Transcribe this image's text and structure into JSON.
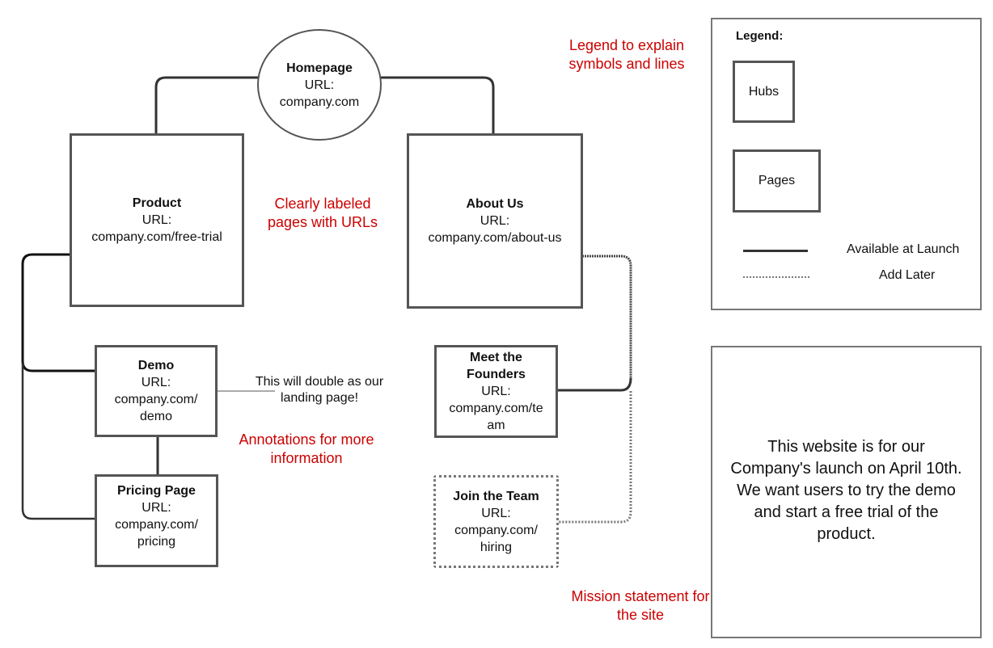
{
  "nodes": {
    "homepage": {
      "title": "Homepage",
      "url_label": "URL:",
      "url": "company.com"
    },
    "product": {
      "title": "Product",
      "url_label": "URL:",
      "url": "company.com/free-trial"
    },
    "about": {
      "title": "About Us",
      "url_label": "URL:",
      "url": "company.com/about-us"
    },
    "demo": {
      "title": "Demo",
      "url_label": "URL:",
      "url": "company.com/ demo"
    },
    "pricing": {
      "title": "Pricing Page",
      "url_label": "URL:",
      "url": "company.com/ pricing"
    },
    "founders": {
      "title": "Meet the Founders",
      "url_label": "URL:",
      "url": "company.com/team"
    },
    "join": {
      "title": "Join the Team",
      "url_label": "URL:",
      "url": "company.com/ hiring"
    }
  },
  "annotations": {
    "legend_note": "Legend to explain symbols and lines",
    "labels_note": "Clearly labeled pages with URLs",
    "annotations_note": "Annotations for more information",
    "mission_note": "Mission statement for the site",
    "demo_callout": "This will double as our landing page!"
  },
  "legend": {
    "title": "Legend:",
    "hubs": "Hubs",
    "pages": "Pages",
    "solid": "Available at Launch",
    "dotted": "Add Later"
  },
  "mission": "This website is for our Company's launch on April 10th. We want users to try the demo and start a free trial of the product.",
  "colors": {
    "annotation": "#cc0000",
    "line": "#333333",
    "border": "#555555"
  }
}
